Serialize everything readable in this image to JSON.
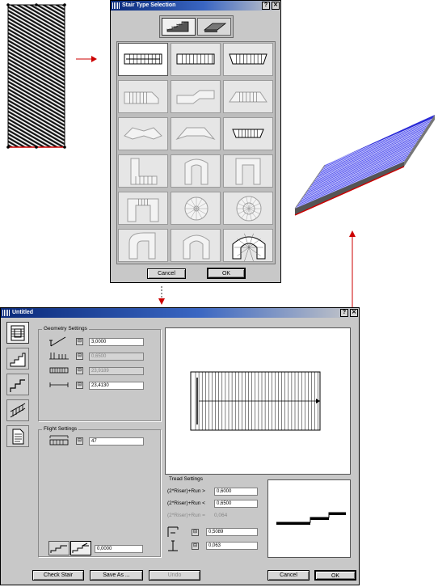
{
  "stair_type_dialog": {
    "title": "Stair Type Selection",
    "help_label": "?",
    "close_label": "✕",
    "cancel_label": "Cancel",
    "ok_label": "OK"
  },
  "stair_settings_dialog": {
    "title": "Untitled",
    "help_label": "?",
    "close_label": "✕",
    "geometry": {
      "group_label": "Geometry Settings",
      "fields": [
        "3,0000",
        "0,6500",
        "23,9189",
        "23,4130"
      ]
    },
    "flight": {
      "group_label": "Flight Settings",
      "steps_value": "47",
      "bottom_value": "0,0000"
    },
    "tread": {
      "group_label": "Tread Settings",
      "rows": [
        {
          "label": "(2*Riser)+Run >",
          "value": "0,6000"
        },
        {
          "label": "(2*Riser)+Run <",
          "value": "0,6500"
        },
        {
          "label": "(2*Riser)+Run =",
          "value": "0,064"
        }
      ],
      "tread_depth": "0,5089",
      "riser_height": "0,063"
    },
    "buttons": {
      "check": "Check Stair",
      "save_as": "Save As ...",
      "undo": "Undo",
      "cancel": "Cancel",
      "ok": "OK"
    }
  },
  "colors": {
    "title_bar": "#0a2a7a",
    "arrow": "#cc0000",
    "stair_3d": "#1a1aee"
  }
}
